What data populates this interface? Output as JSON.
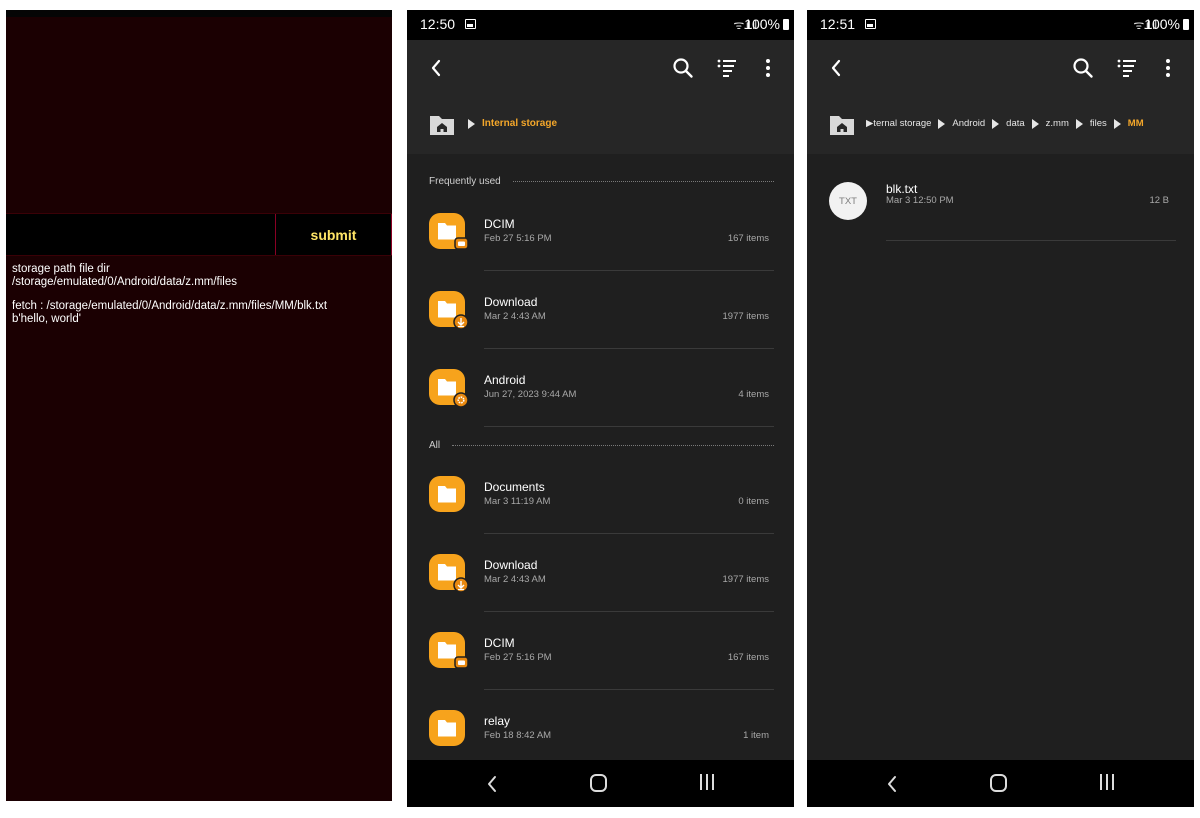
{
  "app_screen": {
    "input_value": "",
    "submit_label": "submit",
    "log_lines": [
      "storage path file dir",
      "/storage/emulated/0/Android/data/z.mm/files",
      "",
      "fetch : /storage/emulated/0/Android/data/z.mm/files/MM/blk.txt",
      "b'hello, world'"
    ]
  },
  "file_manager_root": {
    "status_time": "12:50",
    "battery": "100%",
    "breadcrumb_current": "Internal storage",
    "frequently_used_label": "Frequently used",
    "all_label": "All",
    "frequently_used": [
      {
        "name": "DCIM",
        "date": "Feb 27 5:16 PM",
        "count": "167 items",
        "badge": "camera-badge-icon"
      },
      {
        "name": "Download",
        "date": "Mar 2 4:43 AM",
        "count": "1977 items",
        "badge": "download-badge-icon"
      },
      {
        "name": "Android",
        "date": "Jun 27, 2023 9:44 AM",
        "count": "4 items",
        "badge": "settings-badge-icon"
      }
    ],
    "all": [
      {
        "name": "Documents",
        "date": "Mar 3 11:19 AM",
        "count": "0 items",
        "badge": ""
      },
      {
        "name": "Download",
        "date": "Mar 2 4:43 AM",
        "count": "1977 items",
        "badge": "download-badge-icon"
      },
      {
        "name": "DCIM",
        "date": "Feb 27 5:16 PM",
        "count": "167 items",
        "badge": "camera-badge-icon"
      },
      {
        "name": "relay",
        "date": "Feb 18 8:42 AM",
        "count": "1 item",
        "badge": ""
      }
    ]
  },
  "file_manager_mm": {
    "status_time": "12:51",
    "battery": "100%",
    "breadcrumbs": [
      "▶ternal storage",
      "Android",
      "data",
      "z.mm",
      "files"
    ],
    "breadcrumb_current": "MM",
    "file": {
      "icon_label": "TXT",
      "name": "blk.txt",
      "date": "Mar 3 12:50 PM",
      "size": "12 B"
    }
  },
  "colors": {
    "accent": "#f4a72a",
    "submit_text": "#ffe566",
    "app_bg": "#1b0002"
  }
}
